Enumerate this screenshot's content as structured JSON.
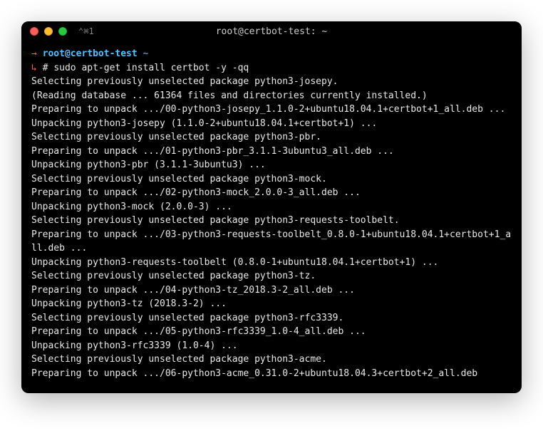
{
  "titlebar": {
    "extra": "⌃⌘1",
    "title": "root@certbot-test: ~"
  },
  "prompt": {
    "arrow": "→",
    "host": "root@certbot-test",
    "path": "~",
    "branch_arrow": "↳",
    "marker": "#",
    "command": "sudo apt-get install certbot -y -qq"
  },
  "output": [
    "Selecting previously unselected package python3-josepy.",
    "(Reading database ... 61364 files and directories currently installed.)",
    "Preparing to unpack .../00-python3-josepy_1.1.0-2+ubuntu18.04.1+certbot+1_all.deb ...",
    "Unpacking python3-josepy (1.1.0-2+ubuntu18.04.1+certbot+1) ...",
    "Selecting previously unselected package python3-pbr.",
    "Preparing to unpack .../01-python3-pbr_3.1.1-3ubuntu3_all.deb ...",
    "Unpacking python3-pbr (3.1.1-3ubuntu3) ...",
    "Selecting previously unselected package python3-mock.",
    "Preparing to unpack .../02-python3-mock_2.0.0-3_all.deb ...",
    "Unpacking python3-mock (2.0.0-3) ...",
    "Selecting previously unselected package python3-requests-toolbelt.",
    "Preparing to unpack .../03-python3-requests-toolbelt_0.8.0-1+ubuntu18.04.1+certbot+1_all.deb ...",
    "Unpacking python3-requests-toolbelt (0.8.0-1+ubuntu18.04.1+certbot+1) ...",
    "Selecting previously unselected package python3-tz.",
    "Preparing to unpack .../04-python3-tz_2018.3-2_all.deb ...",
    "Unpacking python3-tz (2018.3-2) ...",
    "Selecting previously unselected package python3-rfc3339.",
    "Preparing to unpack .../05-python3-rfc3339_1.0-4_all.deb ...",
    "Unpacking python3-rfc3339 (1.0-4) ...",
    "Selecting previously unselected package python3-acme.",
    "Preparing to unpack .../06-python3-acme_0.31.0-2+ubuntu18.04.3+certbot+2_all.deb"
  ]
}
